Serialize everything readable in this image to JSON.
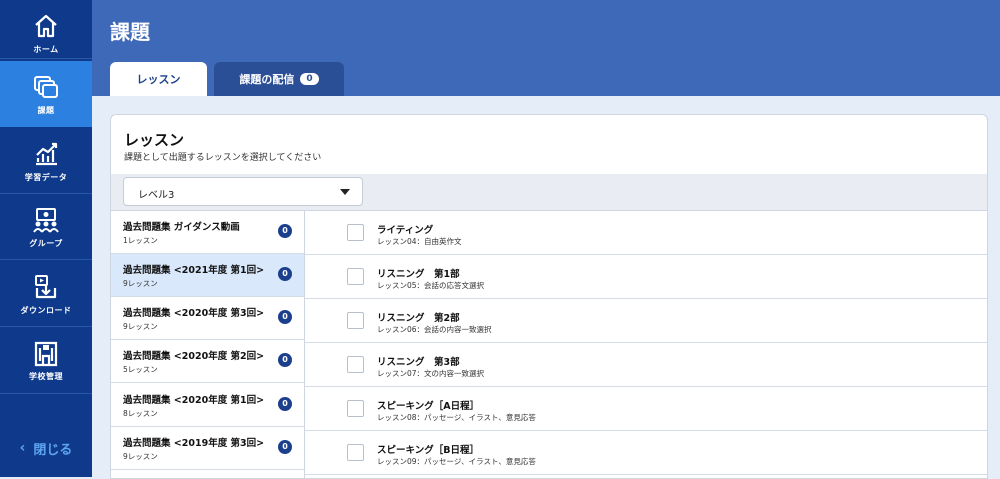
{
  "sidebar": {
    "items": [
      {
        "label": "ホーム",
        "icon": "home-icon"
      },
      {
        "label": "課題",
        "icon": "assignment-icon"
      },
      {
        "label": "学習データ",
        "icon": "chart-icon"
      },
      {
        "label": "グループ",
        "icon": "group-icon"
      },
      {
        "label": "ダウンロード",
        "icon": "download-icon"
      },
      {
        "label": "学校管理",
        "icon": "school-icon"
      }
    ],
    "active_index": 1,
    "close_label": "閉じる",
    "close_glyph": "‹"
  },
  "header": {
    "title": "課題",
    "tabs": [
      {
        "label": "レッスン"
      },
      {
        "label": "課題の配信",
        "badge": "0"
      }
    ]
  },
  "main": {
    "title": "レッスン",
    "subtitle": "課題として出題するレッスンを選択してください",
    "level_select": {
      "value": "レベル3"
    },
    "courses": [
      {
        "name": "過去問題集 ガイダンス動画",
        "count": "1レッスン",
        "badge": "0"
      },
      {
        "name": "過去問題集 <2021年度 第1回>",
        "count": "9レッスン",
        "badge": "0"
      },
      {
        "name": "過去問題集 <2020年度 第3回>",
        "count": "9レッスン",
        "badge": "0"
      },
      {
        "name": "過去問題集 <2020年度 第2回>",
        "count": "5レッスン",
        "badge": "0"
      },
      {
        "name": "過去問題集 <2020年度 第1回>",
        "count": "8レッスン",
        "badge": "0"
      },
      {
        "name": "過去問題集 <2019年度 第3回>",
        "count": "9レッスン",
        "badge": "0"
      }
    ],
    "selected_course_index": 1,
    "lessons": [
      {
        "name": "ライティング",
        "sub": "レッスン04：自由英作文"
      },
      {
        "name": "リスニング　第1部",
        "sub": "レッスン05：会話の応答文選択"
      },
      {
        "name": "リスニング　第2部",
        "sub": "レッスン06：会話の内容一致選択"
      },
      {
        "name": "リスニング　第3部",
        "sub": "レッスン07：文の内容一致選択"
      },
      {
        "name": "スピーキング［A日程］",
        "sub": "レッスン08：パッセージ、イラスト、意見応答"
      },
      {
        "name": "スピーキング［B日程］",
        "sub": "レッスン09：パッセージ、イラスト、意見応答"
      }
    ]
  },
  "colors": {
    "sidebar": "#0f3a8c",
    "sidebar_active": "#2b80e0",
    "header": "#3e68b8",
    "badge": "#1b3f8c",
    "selected_row": "#d9e8fb"
  }
}
